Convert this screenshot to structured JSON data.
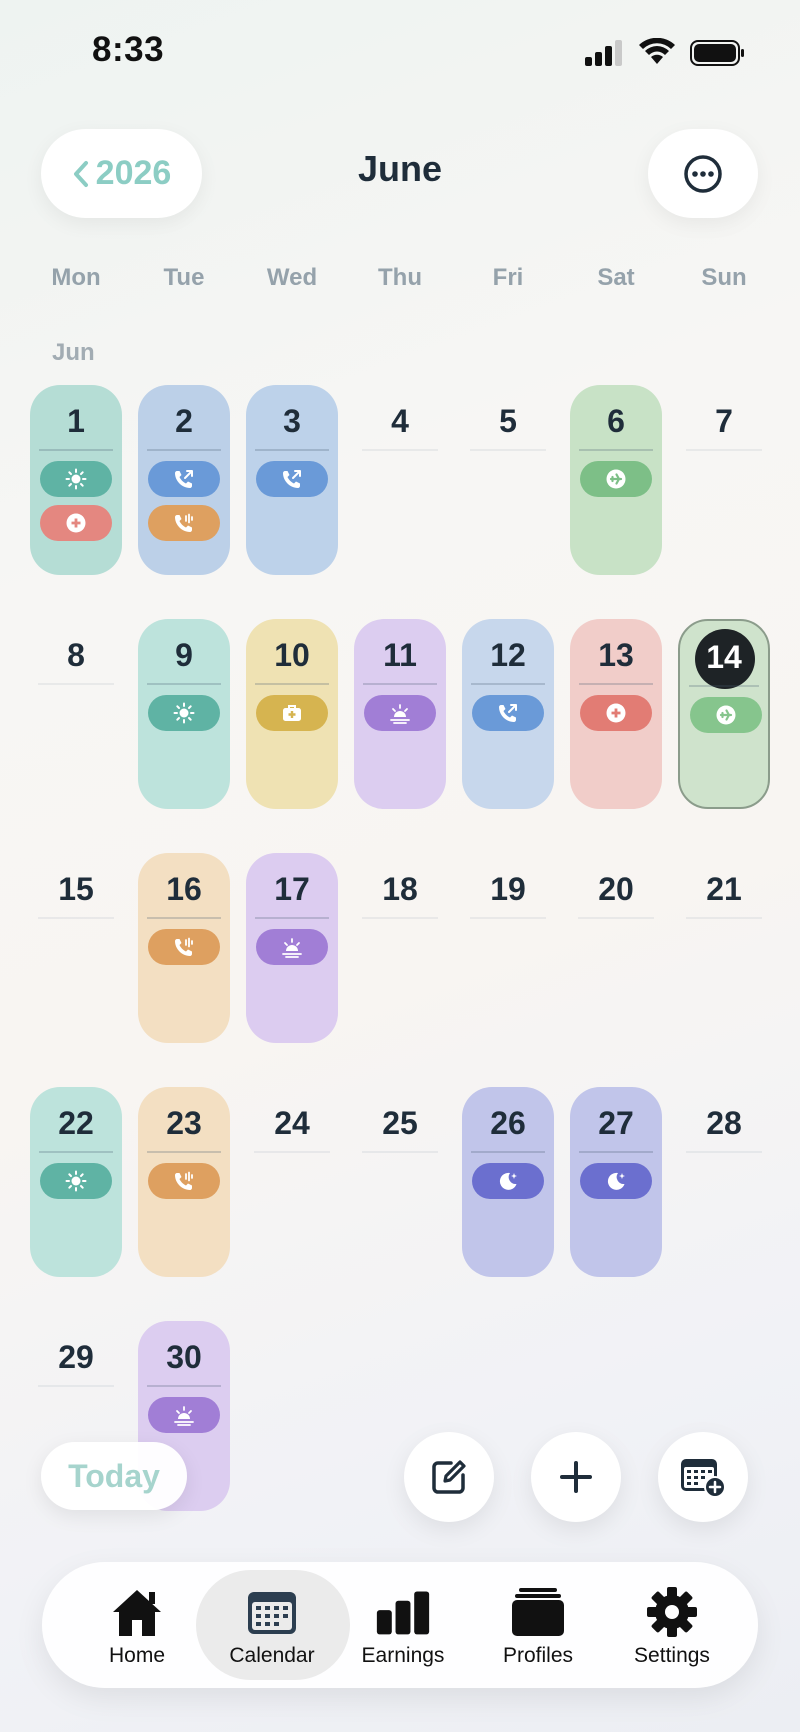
{
  "status_bar": {
    "time": "8:33"
  },
  "header": {
    "year_button": "2026",
    "month_title": "June"
  },
  "weekdays": [
    "Mon",
    "Tue",
    "Wed",
    "Thu",
    "Fri",
    "Sat",
    "Sun"
  ],
  "month_label": "Jun",
  "days": [
    {
      "n": "1",
      "bg": "#b5ddd5",
      "pills": [
        {
          "c": "#5fb3a4",
          "icon": "sun-icon"
        },
        {
          "c": "#e48780",
          "icon": "medical-plus-icon"
        }
      ]
    },
    {
      "n": "2",
      "bg": "#bcd0e8",
      "pills": [
        {
          "c": "#6a9ad8",
          "icon": "phone-outgoing-icon"
        },
        {
          "c": "#dea060",
          "icon": "phone-ring-icon"
        }
      ]
    },
    {
      "n": "3",
      "bg": "#bdd2ea",
      "pills": [
        {
          "c": "#6a9ad8",
          "icon": "phone-outgoing-icon"
        }
      ]
    },
    {
      "n": "4",
      "bg": "",
      "pills": []
    },
    {
      "n": "5",
      "bg": "",
      "pills": []
    },
    {
      "n": "6",
      "bg": "#c8e2c6",
      "pills": [
        {
          "c": "#7dbf87",
          "icon": "airplane-icon"
        }
      ]
    },
    {
      "n": "7",
      "bg": "",
      "pills": []
    },
    {
      "n": "8",
      "bg": "",
      "pills": []
    },
    {
      "n": "9",
      "bg": "#bde3dc",
      "pills": [
        {
          "c": "#5fb3a4",
          "icon": "sun-icon"
        }
      ]
    },
    {
      "n": "10",
      "bg": "#efe2b3",
      "pills": [
        {
          "c": "#d6b450",
          "icon": "first-aid-kit-icon"
        }
      ]
    },
    {
      "n": "11",
      "bg": "#dccdf0",
      "pills": [
        {
          "c": "#a17ed6",
          "icon": "sunrise-icon"
        }
      ]
    },
    {
      "n": "12",
      "bg": "#c7d7ec",
      "pills": [
        {
          "c": "#6a9ad8",
          "icon": "phone-outgoing-icon"
        }
      ]
    },
    {
      "n": "13",
      "bg": "#f1cdc9",
      "pills": [
        {
          "c": "#e27c74",
          "icon": "medical-plus-icon"
        }
      ]
    },
    {
      "n": "14",
      "bg": "#cfe3cc",
      "pills": [
        {
          "c": "#86c58d",
          "icon": "airplane-icon"
        }
      ],
      "today": true
    },
    {
      "n": "15",
      "bg": "",
      "pills": []
    },
    {
      "n": "16",
      "bg": "#f3dfc2",
      "pills": [
        {
          "c": "#dea060",
          "icon": "phone-ring-icon"
        }
      ]
    },
    {
      "n": "17",
      "bg": "#dcccf0",
      "pills": [
        {
          "c": "#a17ed6",
          "icon": "sunrise-icon"
        }
      ]
    },
    {
      "n": "18",
      "bg": "",
      "pills": []
    },
    {
      "n": "19",
      "bg": "",
      "pills": []
    },
    {
      "n": "20",
      "bg": "",
      "pills": []
    },
    {
      "n": "21",
      "bg": "",
      "pills": []
    },
    {
      "n": "22",
      "bg": "#bde3dc",
      "pills": [
        {
          "c": "#5fb3a4",
          "icon": "sun-icon"
        }
      ]
    },
    {
      "n": "23",
      "bg": "#f3dfc2",
      "pills": [
        {
          "c": "#dea060",
          "icon": "phone-ring-icon"
        }
      ]
    },
    {
      "n": "24",
      "bg": "",
      "pills": []
    },
    {
      "n": "25",
      "bg": "",
      "pills": []
    },
    {
      "n": "26",
      "bg": "#c1c5ea",
      "pills": [
        {
          "c": "#6b6fcf",
          "icon": "moon-icon"
        }
      ]
    },
    {
      "n": "27",
      "bg": "#c1c5ea",
      "pills": [
        {
          "c": "#6b6fcf",
          "icon": "moon-icon"
        }
      ]
    },
    {
      "n": "28",
      "bg": "",
      "pills": []
    },
    {
      "n": "29",
      "bg": "",
      "pills": []
    },
    {
      "n": "30",
      "bg": "#dccdf0",
      "pills": [
        {
          "c": "#a17ed6",
          "icon": "sunrise-icon"
        }
      ]
    }
  ],
  "bottom_actions": {
    "today_button": "Today"
  },
  "tabbar": {
    "items": [
      {
        "label": "Home",
        "icon": "home-icon"
      },
      {
        "label": "Calendar",
        "icon": "calendar-icon",
        "active": true
      },
      {
        "label": "Earnings",
        "icon": "bar-chart-icon"
      },
      {
        "label": "Profiles",
        "icon": "stack-icon"
      },
      {
        "label": "Settings",
        "icon": "gear-icon"
      }
    ]
  }
}
